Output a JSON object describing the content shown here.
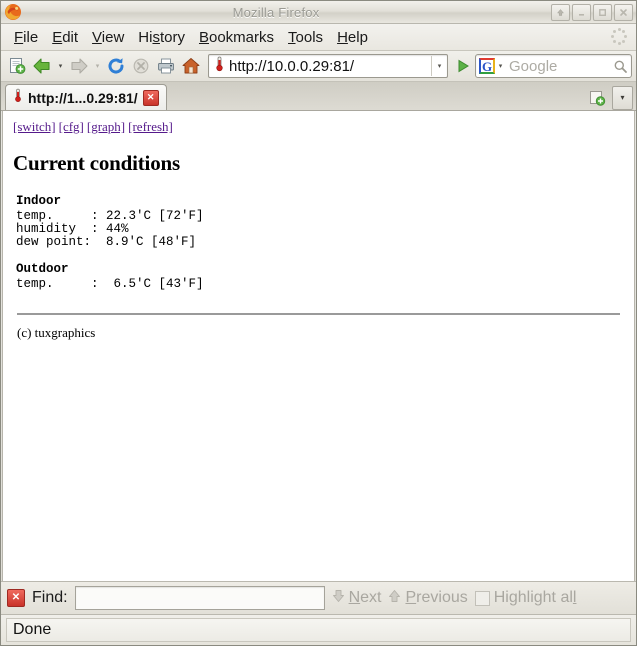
{
  "window": {
    "title": "Mozilla Firefox",
    "app_icon": "firefox-icon",
    "buttons": [
      {
        "name": "shade-button",
        "glyph": "⬆"
      },
      {
        "name": "minimize-button",
        "glyph": "–"
      },
      {
        "name": "maximize-button",
        "glyph": "❐"
      },
      {
        "name": "close-button",
        "glyph": "✕"
      }
    ]
  },
  "menubar": {
    "items": [
      {
        "name": "menu-file",
        "pre": "",
        "key": "F",
        "post": "ile"
      },
      {
        "name": "menu-edit",
        "pre": "",
        "key": "E",
        "post": "dit"
      },
      {
        "name": "menu-view",
        "pre": "",
        "key": "V",
        "post": "iew"
      },
      {
        "name": "menu-history",
        "pre": "Hi",
        "key": "s",
        "post": "tory"
      },
      {
        "name": "menu-bookmarks",
        "pre": "",
        "key": "B",
        "post": "ookmarks"
      },
      {
        "name": "menu-tools",
        "pre": "",
        "key": "T",
        "post": "ools"
      },
      {
        "name": "menu-help",
        "pre": "",
        "key": "H",
        "post": "elp"
      }
    ],
    "throbber": "activity-indicator"
  },
  "toolbar": {
    "new_tab_icon": "new-tab-icon",
    "back_icon": "back-arrow-icon",
    "forward_icon": "forward-arrow-icon",
    "reload_icon": "reload-icon",
    "stop_icon": "stop-icon",
    "print_icon": "print-icon",
    "home_icon": "home-icon",
    "dropdown_glyph": "▾",
    "go_glyph": "▶"
  },
  "urlbar": {
    "favicon": "thermometer-icon",
    "value": "http://10.0.0.29:81/",
    "dropdown_glyph": "▾"
  },
  "search": {
    "engine_icon": "google-g-icon",
    "engine_letter": "G",
    "dropdown_glyph": "▾",
    "placeholder": "Google",
    "magnifier_icon": "search-icon"
  },
  "tabbar": {
    "tab": {
      "favicon": "thermometer-icon",
      "title": "http://1...0.29:81/",
      "close_glyph": "✕"
    },
    "new_tab_icon": "new-tab-icon",
    "tab_list_glyph": "▾"
  },
  "page": {
    "nav_links": [
      {
        "name": "link-switch",
        "label": "[switch]"
      },
      {
        "name": "link-cfg",
        "label": "[cfg]"
      },
      {
        "name": "link-graph",
        "label": "[graph]"
      },
      {
        "name": "link-refresh",
        "label": "[refresh]"
      }
    ],
    "heading": "Current conditions",
    "indoor": {
      "heading": "Indoor",
      "lines": "temp.     : 22.3'C [72'F]\nhumidity  : 44%\ndew point:  8.9'C [48'F]"
    },
    "outdoor": {
      "heading": "Outdoor",
      "lines": "temp.     :  6.5'C [43'F]"
    },
    "readings": {
      "indoor_temp_c": 22.3,
      "indoor_temp_f": 72,
      "indoor_humidity_pct": 44,
      "indoor_dew_point_c": 8.9,
      "indoor_dew_point_f": 48,
      "outdoor_temp_c": 6.5,
      "outdoor_temp_f": 43
    },
    "copyright": "(c) tuxgraphics"
  },
  "findbar": {
    "close_glyph": "✕",
    "label": "Find:",
    "input_value": "",
    "next": {
      "pre": "",
      "key": "N",
      "post": "ext",
      "glyph": "⬇"
    },
    "previous": {
      "pre": "",
      "key": "P",
      "post": "revious",
      "glyph": "⬆"
    },
    "highlight": {
      "pre": "Highlight al",
      "key": "l",
      "post": ""
    }
  },
  "statusbar": {
    "text": "Done"
  },
  "colors": {
    "link": "#551a8b",
    "accent_green": "#2f9e41",
    "close_red": "#c9332a",
    "chrome_bg": "#e4e2da",
    "content_bg": "#ffffff"
  }
}
